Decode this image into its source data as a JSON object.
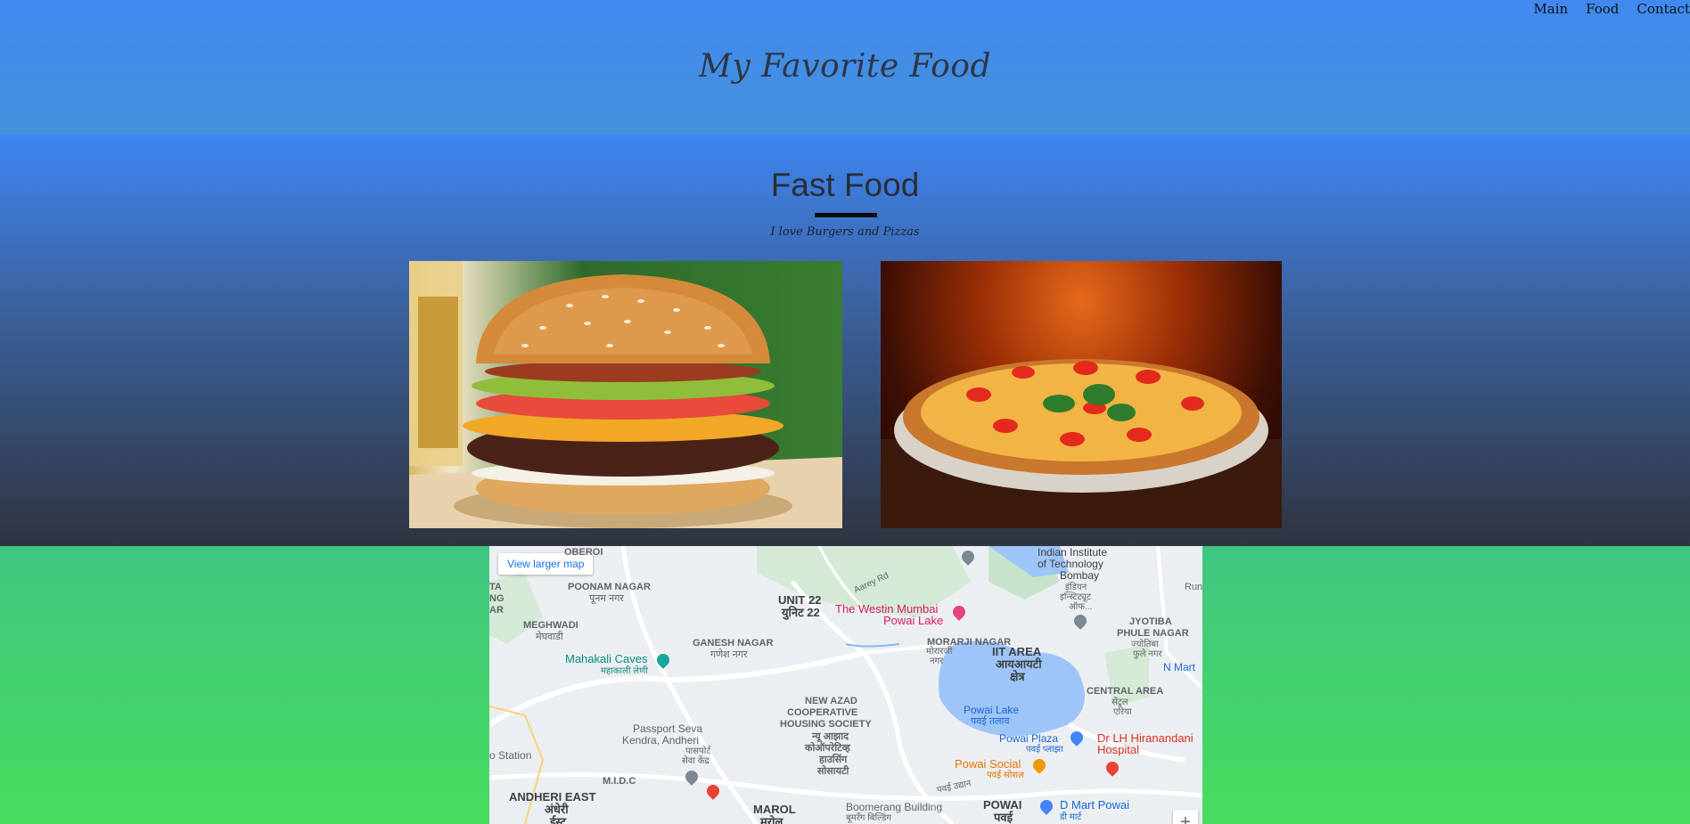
{
  "nav": {
    "items": [
      "Main",
      "Food",
      "Contact"
    ]
  },
  "header": {
    "title": "My Favorite Food"
  },
  "section": {
    "title": "Fast Food",
    "subtitle": "I love Burgers and Pizzas"
  },
  "images": [
    {
      "name": "burger"
    },
    {
      "name": "pizza"
    }
  ],
  "map": {
    "view_larger": "View larger map",
    "zoom_in": "+",
    "labels": {
      "oberoi": "OBEROI",
      "poonam_nagar": "POONAM NAGAR",
      "poonam_nagar_hi": "पूनम नगर",
      "meghwadi": "MEGHWADI",
      "meghwadi_hi": "मेघवाडी",
      "mahakali": "Mahakali Caves",
      "mahakali_hi": "महाकाली लेणी",
      "ganesh_nagar": "GANESH NAGAR",
      "ganesh_nagar_hi": "गणेश नगर",
      "unit22": "UNIT 22",
      "unit22_hi": "युनिट 22",
      "aarey": "Aarey Rd",
      "westin": "The Westin Mumbai",
      "westin2": "Powai Lake",
      "morarji": "MORARJI NAGAR",
      "morarji_hi": "मोरारजी",
      "morarji_hi2": "नगर",
      "iit_area": "IIT AREA",
      "iit_area_hi": "आयआयटी",
      "iit_area_hi2": "क्षेत्र",
      "iit": "Indian Institute",
      "iit2": "of Technology",
      "iit3": "Bombay",
      "iit_hi": "इंडियन",
      "iit_hi2": "इन्स्टिट्यूट",
      "iit_hi3": "ऑफ...",
      "jyotiba": "JYOTIBA",
      "jyotiba2": "PHULE NAGAR",
      "jyotiba_hi": "ज्योतिबा",
      "jyotiba_hi2": "फुले नगर",
      "central": "CENTRAL AREA",
      "central_hi": "सेंट्रल",
      "central_hi2": "एरिया",
      "new_azad": "NEW AZAD",
      "new_azad2": "COOPERATIVE",
      "new_azad3": "HOUSING SOCIETY",
      "new_azad_hi": "न्यू आझाद",
      "new_azad_hi2": "कोऑपरेटिव्ह",
      "new_azad_hi3": "हाउसिंग",
      "new_azad_hi4": "सोसायटी",
      "powai_lake": "Powai Lake",
      "powai_lake_hi": "पवई तलाव",
      "powai_plaza": "Powai Plaza",
      "powai_plaza_hi": "पवई प्लाझा",
      "powai_social": "Powai Social",
      "powai_social_hi": "पवई सोशल",
      "hiranandani": "Dr LH Hiranandani",
      "hiranandani2": "Hospital",
      "passport": "Passport Seva",
      "passport2": "Kendra, Andheri",
      "passport_hi": "पासपोर्ट",
      "passport_hi2": "सेवा केंद्र",
      "midc": "M.I.D.C",
      "station": "o Station",
      "andheri_east": "ANDHERI EAST",
      "andheri_east_hi": "अंधेरी",
      "andheri_east_hi2": "ईस्ट",
      "marol": "MAROL",
      "marol_hi": "मरोल",
      "boomerang": "Boomerang Building",
      "boomerang_hi": "बूमरँग बिल्डिंग",
      "powai": "POWAI",
      "powai_hi": "पवई",
      "powai_udyan": "पवई उद्यान",
      "dmart": "D Mart Powai",
      "dmart_hi": "डी मार्ट",
      "nmart": "N Mart",
      "run": "Run",
      "edge_ta": "TA",
      "edge_ng": "NG",
      "edge_ar": "AR"
    }
  },
  "colors": {
    "header_top": "#4189f0",
    "section_bottom": "#2f3440",
    "page_green": "#47dd5e",
    "map_link": "#1a73e8"
  }
}
